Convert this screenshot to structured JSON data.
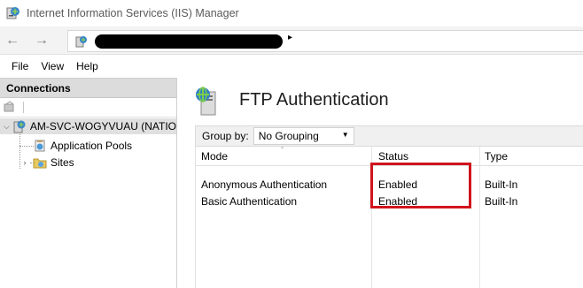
{
  "window": {
    "title": "Internet Information Services (IIS) Manager"
  },
  "address_bar": {
    "back_glyph": "←",
    "forward_glyph": "→",
    "path_separator": "▸",
    "icon": "server-icon"
  },
  "menu": {
    "items": [
      "File",
      "View",
      "Help"
    ]
  },
  "connections": {
    "header": "Connections",
    "tree": [
      {
        "label": "AM-SVC-WOGYVUAU (NATIO",
        "icon": "server-icon",
        "expanded": true,
        "selected": true
      },
      {
        "label": "Application Pools",
        "icon": "app-pools-icon"
      },
      {
        "label": "Sites",
        "icon": "sites-folder-icon",
        "expanded": false
      }
    ]
  },
  "feature": {
    "title": "FTP Authentication",
    "icon": "ftp-authentication-icon"
  },
  "group_by": {
    "label": "Group by:",
    "selected": "No Grouping"
  },
  "table": {
    "columns": [
      "Mode",
      "Status",
      "Type"
    ],
    "rows": [
      {
        "mode": "Anonymous Authentication",
        "status": "Enabled",
        "type": "Built-In"
      },
      {
        "mode": "Basic Authentication",
        "status": "Enabled",
        "type": "Built-In"
      }
    ]
  },
  "colors": {
    "highlight_border": "#d0141c",
    "connections_header_bg": "#dcdcdc"
  }
}
